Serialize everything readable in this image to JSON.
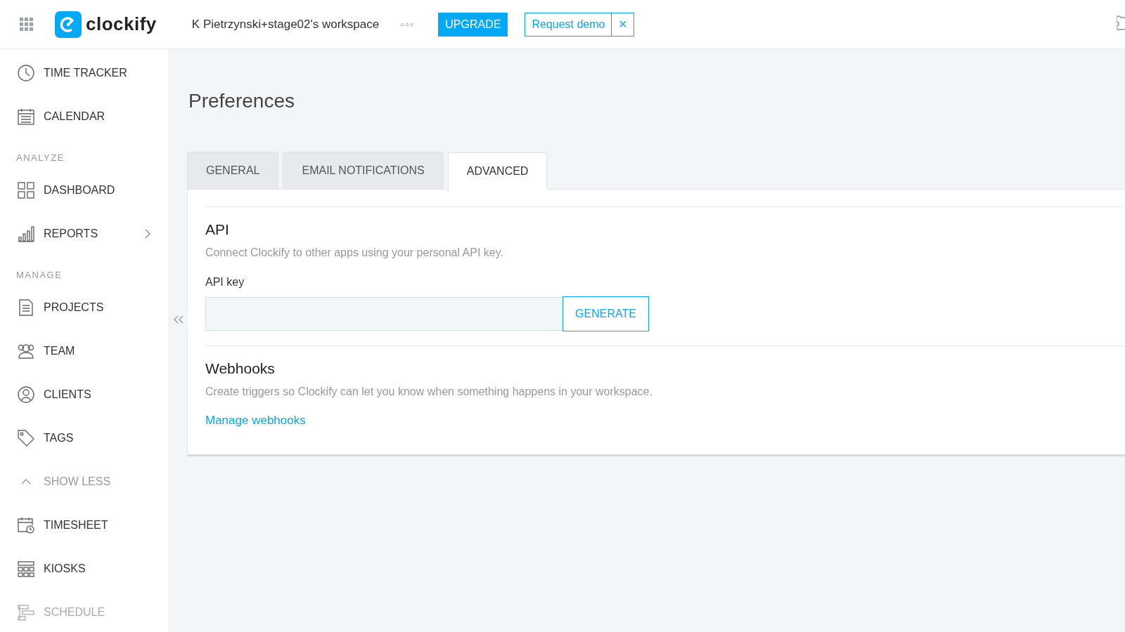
{
  "header": {
    "logo_text": "clockify",
    "workspace": "K Pietrzynski+stage02's workspace",
    "more": "◦◦◦",
    "upgrade_button": "UPGRADE",
    "demo_button": "Request demo",
    "close": "×"
  },
  "sidebar": {
    "items": [
      {
        "kind": "item",
        "label": "TIME TRACKER",
        "selected": false,
        "disabled": false
      },
      {
        "kind": "item",
        "label": "CALENDAR",
        "selected": false,
        "disabled": false
      },
      {
        "kind": "section",
        "label": "ANALYZE"
      },
      {
        "kind": "item",
        "label": "DASHBOARD",
        "selected": false,
        "disabled": false
      },
      {
        "kind": "item",
        "label": "REPORTS",
        "selected": false,
        "disabled": false,
        "submenu": true
      },
      {
        "kind": "section",
        "label": "MANAGE"
      },
      {
        "kind": "item",
        "label": "PROJECTS",
        "selected": false,
        "disabled": false
      },
      {
        "kind": "item",
        "label": "TEAM",
        "selected": false,
        "disabled": false
      },
      {
        "kind": "item",
        "label": "CLIENTS",
        "selected": false,
        "disabled": false
      },
      {
        "kind": "item",
        "label": "TAGS",
        "selected": false,
        "disabled": false
      },
      {
        "kind": "toggle",
        "label": "SHOW LESS",
        "expanded": true
      },
      {
        "kind": "item",
        "label": "TIMESHEET",
        "selected": false,
        "disabled": false
      },
      {
        "kind": "item",
        "label": "KIOSKS",
        "selected": false,
        "disabled": false
      },
      {
        "kind": "item",
        "label": "SCHEDULE",
        "selected": false,
        "disabled": true
      }
    ]
  },
  "page": {
    "title": "Preferences",
    "tabs": [
      {
        "label": "GENERAL",
        "selected": false
      },
      {
        "label": "EMAIL NOTIFICATIONS",
        "selected": false
      },
      {
        "label": "ADVANCED",
        "selected": true
      }
    ],
    "api": {
      "heading": "API",
      "description": "Connect Clockify to other apps using your personal API key.",
      "field_label": "API key",
      "button": "GENERATE"
    },
    "webhooks": {
      "heading": "Webhooks",
      "description": "Create triggers so Clockify can let you know when something happens in your workspace.",
      "link": "Manage webhooks"
    }
  }
}
